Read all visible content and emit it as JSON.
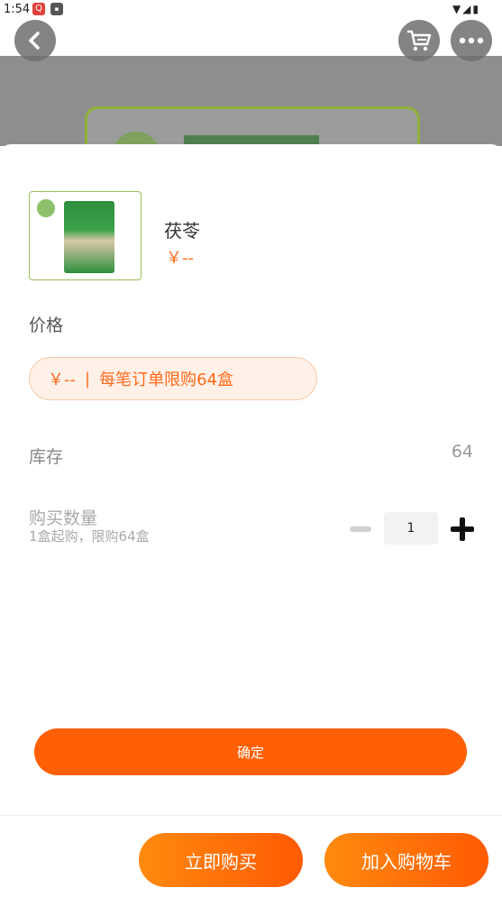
{
  "status_bar": {
    "time": "1:54",
    "icons": [
      "wifi-icon",
      "signal-icon",
      "battery-icon"
    ]
  },
  "nav": {
    "back_icon": "chevron-left-icon",
    "cart_icon": "cart-icon",
    "more_icon": "more-icon"
  },
  "product": {
    "name": "茯苓",
    "price": "￥--"
  },
  "price_section": {
    "label": "价格",
    "tag_price": "￥--",
    "tag_separator": "|",
    "tag_limit": "每笔订单限购64盒"
  },
  "stock": {
    "label": "库存",
    "value": "64"
  },
  "quantity": {
    "label": "购买数量",
    "hint": "1盒起购，限购64盒",
    "value": "1"
  },
  "confirm_label": "确定",
  "bottom_bar": {
    "buy_now": "立即购买",
    "add_to_cart": "加入购物车"
  },
  "colors": {
    "accent": "#ff6005",
    "price_text": "#ff6a1a",
    "tag_bg": "#fff1e8"
  }
}
